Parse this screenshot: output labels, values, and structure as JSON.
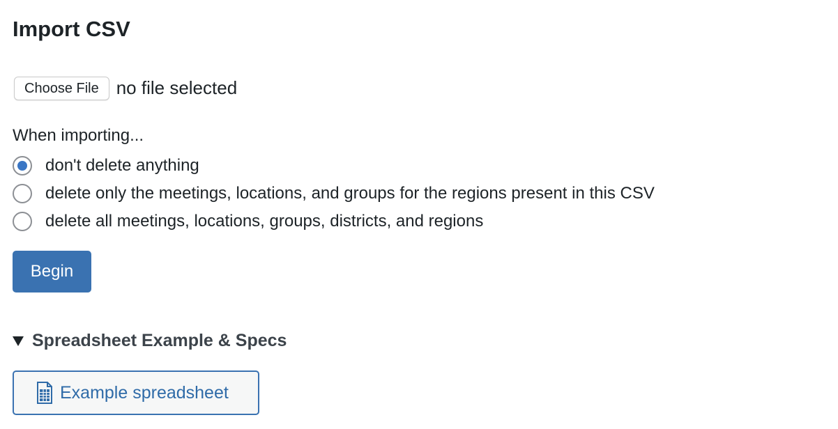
{
  "page": {
    "title": "Import CSV"
  },
  "file_input": {
    "button_label": "Choose File",
    "status": "no file selected"
  },
  "import_options": {
    "label": "When importing...",
    "options": [
      {
        "label": "don't delete anything",
        "checked": true
      },
      {
        "label": "delete only the meetings, locations, and groups for the regions present in this CSV",
        "checked": false
      },
      {
        "label": "delete all meetings, locations, groups, districts, and regions",
        "checked": false
      }
    ]
  },
  "begin_button": {
    "label": "Begin"
  },
  "specs": {
    "summary": "Spreadsheet Example & Specs",
    "example_button_label": "Example spreadsheet",
    "example_icon": "spreadsheet-icon"
  },
  "colors": {
    "primary": "#3a72b1",
    "radio_checked": "#3a76c4",
    "text": "#1d2327",
    "link": "#2f6ba8"
  }
}
